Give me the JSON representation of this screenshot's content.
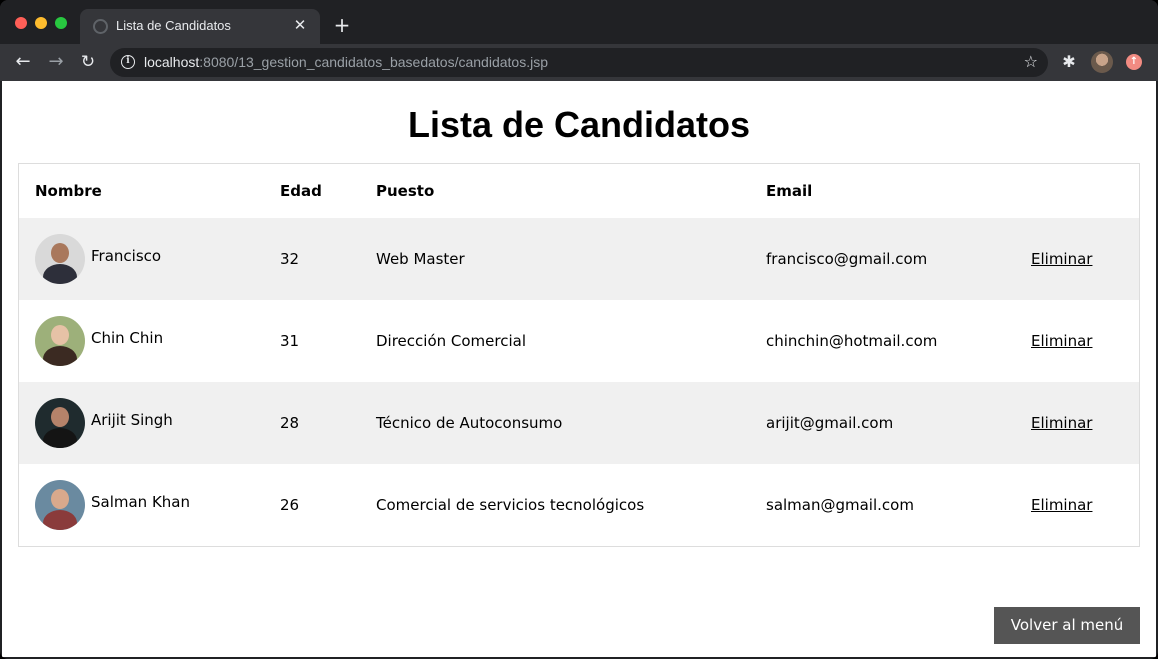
{
  "browser": {
    "tab_title": "Lista de Candidatos",
    "tab_close": "✕",
    "new_tab": "+",
    "url_host": "localhost",
    "url_rest": ":8080/13_gestion_candidatos_basedatos/candidatos.jsp"
  },
  "page": {
    "title": "Lista de Candidatos",
    "headers": {
      "nombre": "Nombre",
      "edad": "Edad",
      "puesto": "Puesto",
      "email": "Email"
    },
    "rows": [
      {
        "nombre": "Francisco",
        "edad": "32",
        "puesto": "Web Master",
        "email": "francisco@gmail.com",
        "action": "Eliminar"
      },
      {
        "nombre": "Chin Chin",
        "edad": "31",
        "puesto": "Dirección Comercial",
        "email": "chinchin@hotmail.com",
        "action": "Eliminar"
      },
      {
        "nombre": "Arijit Singh",
        "edad": "28",
        "puesto": "Técnico de Autoconsumo",
        "email": "arijit@gmail.com",
        "action": "Eliminar"
      },
      {
        "nombre": "Salman Khan",
        "edad": "26",
        "puesto": "Comercial de servicios tecnológicos",
        "email": "salman@gmail.com",
        "action": "Eliminar"
      }
    ],
    "back_button": "Volver al menú"
  },
  "colors": {
    "row_stripe": "#f0f0f0",
    "button_bg": "#555555"
  }
}
